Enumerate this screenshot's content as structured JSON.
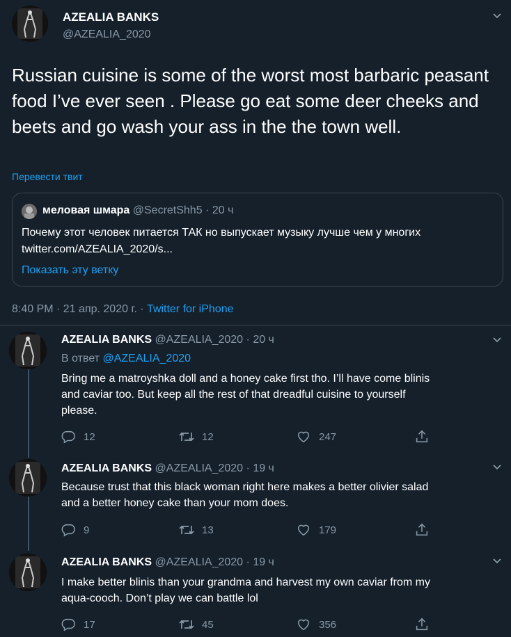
{
  "main_tweet": {
    "display_name": "AZEALIA BANKS",
    "handle": "@AZEALIA_2020",
    "text": "Russian cuisine is some of the worst most barbaric peasant food I’ve ever seen . Please go eat some deer cheeks and beets and go wash your ass in the the town well.",
    "translate_label": "Перевести твит",
    "quoted": {
      "display_name": "меловая шмара",
      "handle": "@SecretShh5",
      "sep": "·",
      "time": "20 ч",
      "text_line1": "Почему этот человек питается ТАК но выпускает музыку лучше чем у многих",
      "text_line2": "twitter.com/AZEALIA_2020/s...",
      "show_thread": "Показать эту ветку"
    },
    "timestamp": "8:40 PM · 21 апр. 2020 г. ·",
    "source": "Twitter for iPhone"
  },
  "replies": [
    {
      "display_name": "AZEALIA BANKS",
      "handle": "@AZEALIA_2020",
      "sep": "·",
      "time": "20 ч",
      "reply_prefix": "В ответ",
      "reply_to": "@AZEALIA_2020",
      "lines": [
        "Bring me a matroyshka doll and a honey cake first tho. I’ll have come blinis",
        "and caviar too. But keep all the rest of that dreadful cuisine to yourself",
        "please."
      ],
      "replies": "12",
      "retweets": "12",
      "likes": "247"
    },
    {
      "display_name": "AZEALIA BANKS",
      "handle": "@AZEALIA_2020",
      "sep": "·",
      "time": "19 ч",
      "lines": [
        "Because trust that this black woman right here makes a better olivier salad",
        "and a better honey cake than your mom does."
      ],
      "replies": "9",
      "retweets": "13",
      "likes": "179"
    },
    {
      "display_name": "AZEALIA BANKS",
      "handle": "@AZEALIA_2020",
      "sep": "·",
      "time": "19 ч",
      "lines": [
        "I make better blinis than your grandma and harvest my own caviar from my",
        "aqua-cooch. Don’t play we can battle lol"
      ],
      "replies": "17",
      "retweets": "45",
      "likes": "356"
    }
  ],
  "icons": [
    "chevron-down-icon",
    "reply-icon",
    "retweet-icon",
    "like-icon",
    "share-icon"
  ],
  "colors": {
    "background": "#15202b",
    "accent": "#1da1f2",
    "muted": "#8899a6",
    "border": "#38444d"
  }
}
